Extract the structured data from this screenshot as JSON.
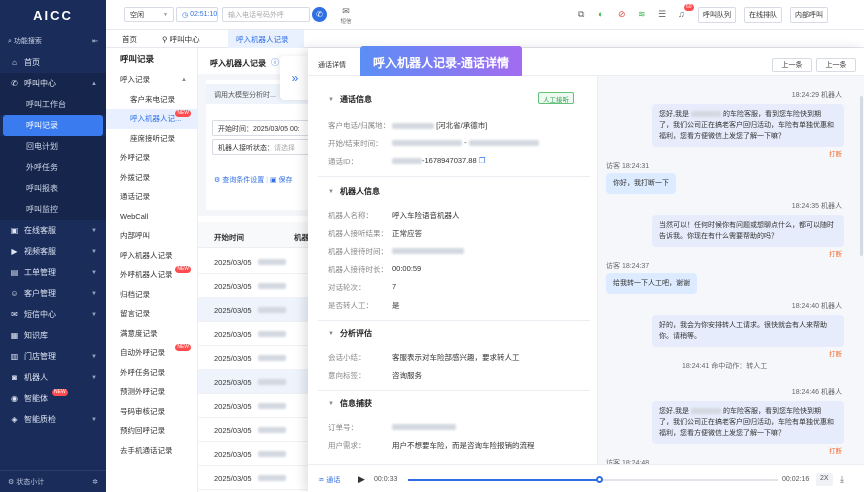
{
  "sidebar": {
    "logo": "AICC",
    "func_search": "功能搜索",
    "items": [
      {
        "label": "首页",
        "icon": "home-icon"
      },
      {
        "label": "呼叫中心",
        "icon": "phone-icon"
      },
      {
        "label": "在线客服",
        "icon": "chat-icon"
      },
      {
        "label": "视频客服",
        "icon": "video-icon"
      },
      {
        "label": "工单管理",
        "icon": "ticket-icon"
      },
      {
        "label": "客户管理",
        "icon": "user-icon"
      },
      {
        "label": "短信中心",
        "icon": "sms-icon"
      },
      {
        "label": "知识库",
        "icon": "book-icon"
      },
      {
        "label": "门店管理",
        "icon": "store-icon"
      },
      {
        "label": "机器人",
        "icon": "robot-icon"
      },
      {
        "label": "智能体",
        "icon": "agent-icon"
      },
      {
        "label": "智能质检",
        "icon": "qc-icon"
      }
    ],
    "sub_items": [
      "呼叫工作台",
      "呼叫记录",
      "回电计划",
      "外呼任务",
      "呼叫报表",
      "呼叫监控"
    ],
    "new_badge": "NEW",
    "status": "状态小计"
  },
  "topbar": {
    "status_select": "空闲",
    "timer": "02:51:10",
    "phone_placeholder": "输入电话号码外呼",
    "sms": "短信",
    "notif_count": "60",
    "queue_btn": "呼叫队列",
    "online_btn": "在线排队",
    "internal_btn": "内部呼叫"
  },
  "tabs": [
    "首页",
    "呼叫中心",
    "呼入机器人记录"
  ],
  "menu2": {
    "title": "呼叫记录",
    "items": [
      {
        "label": "呼入记录",
        "sub": false,
        "chev": true
      },
      {
        "label": "客户来电记录",
        "sub": true
      },
      {
        "label": "呼入机器人记...",
        "sub": true,
        "active": true,
        "new": true
      },
      {
        "label": "座席接听记录",
        "sub": true
      },
      {
        "label": "外呼记录",
        "sub": false
      },
      {
        "label": "外拨记录",
        "sub": false
      },
      {
        "label": "通话记录",
        "sub": false
      },
      {
        "label": "WebCall",
        "sub": false
      },
      {
        "label": "内部呼叫",
        "sub": false
      },
      {
        "label": "呼入机器人记录",
        "sub": false
      },
      {
        "label": "外呼机器人记录",
        "sub": false,
        "new": true
      },
      {
        "label": "归档记录",
        "sub": false
      },
      {
        "label": "留言记录",
        "sub": false
      },
      {
        "label": "满意度记录",
        "sub": false
      },
      {
        "label": "自动外呼记录",
        "sub": false,
        "new": true
      },
      {
        "label": "外呼任务记录",
        "sub": false
      },
      {
        "label": "预测外呼记录",
        "sub": false
      },
      {
        "label": "号码审核记录",
        "sub": false
      },
      {
        "label": "预约回呼记录",
        "sub": false
      },
      {
        "label": "去手机通话记录",
        "sub": false
      }
    ]
  },
  "main": {
    "title": "呼入机器人记录",
    "hint": "调用大模型分析时...",
    "start_label": "开始时间：",
    "start_value": "2025/03/05 00:",
    "robot_state_label": "机器人接听状态：",
    "robot_state_placeholder": "请选择",
    "query_settings": "查询条件设置",
    "save": "保存",
    "col_start": "开始时间",
    "col_robot": "机器",
    "rows": [
      "2025/03/05",
      "2025/03/05",
      "2025/03/05",
      "2025/03/05",
      "2025/03/05",
      "2025/03/05",
      "2025/03/05",
      "2025/03/05",
      "2025/03/05",
      "2025/03/05"
    ]
  },
  "drawer": {
    "tab": "通话详情",
    "title": "呼入机器人记录-通话详情",
    "prev": "上一条",
    "next": "上一条",
    "sections": {
      "call_info": "通话信息",
      "robot_info": "机器人信息",
      "analysis": "分析评估",
      "capture": "信息捕获"
    },
    "tag_manual": "人工接听",
    "call": {
      "phone_label": "客户电话/归属地：",
      "phone_value": "[河北省/承德市]",
      "time_label": "开始/结束时间：",
      "id_label": "通话ID：",
      "id_value": "-1678947037.88"
    },
    "robot": {
      "name_label": "机器人名称：",
      "name_value": "呼入车险语音机器人",
      "result_label": "机器人接听结果：",
      "result_value": "正常应答",
      "time_label": "机器人接待时间：",
      "dur_label": "机器人接待时长：",
      "dur_value": "00:00:59",
      "turns_label": "对话轮次：",
      "turns_value": "7",
      "transfer_label": "是否转人工：",
      "transfer_value": "是"
    },
    "analysis": {
      "summary_label": "会话小结：",
      "summary_value": "客服表示对车险部感兴趣，要求转人工",
      "intent_label": "意向标签：",
      "intent_value": "咨询服务"
    },
    "capture": {
      "order_label": "订单号：",
      "demand_label": "用户需求：",
      "demand_value": "用户不想要车险，而是咨询车险报销的流程"
    },
    "chat": [
      {
        "role": "bot",
        "time": "18:24:29 机器人",
        "text1": "您好,我是",
        "text1b": "的车险客服，看到您车险快到期",
        "text2": "了，我们公司正在搞老客户回归活动，车险有单独优惠和",
        "text3": "福利，您看方便微信上发您了解一下嘛？",
        "interrupt": "打断"
      },
      {
        "role": "user",
        "time": "访客 18:24:31",
        "text1": "你好，我打断一下"
      },
      {
        "role": "bot",
        "time": "18:24:35 机器人",
        "text1": "当然可以！任何时候你有问题或想聊点什么，都可以随时",
        "text2": "告诉我。你现在有什么需要帮助的吗？",
        "interrupt": "打断"
      },
      {
        "role": "user",
        "time": "访客 18:24:37",
        "text1": "给我转一下人工吧，谢谢"
      },
      {
        "role": "bot",
        "time": "18:24:40 机器人",
        "text1": "好的，我会为你安排转人工请求。很快就会有人来帮助",
        "text2": "你。请稍等。",
        "interrupt": "打断"
      },
      {
        "role": "system",
        "text1": "18:24:41  命中动作：转人工"
      },
      {
        "role": "bot",
        "time": "18:24:46 机器人",
        "text1": "您好,我是",
        "text1b": "的车险客服，看到您车险快到期",
        "text2": "了，我们公司正在搞老客户回归活动，车险有单独优惠和",
        "text3": "福利，您看方便微信上发您了解一下嘛？",
        "interrupt": "打断"
      },
      {
        "role": "user",
        "time": "访客 18:24:48"
      }
    ],
    "audio": {
      "label": "通话",
      "current": "00:0:33",
      "total": "00:02:16",
      "speed": "2X",
      "progress": 0.52
    }
  }
}
